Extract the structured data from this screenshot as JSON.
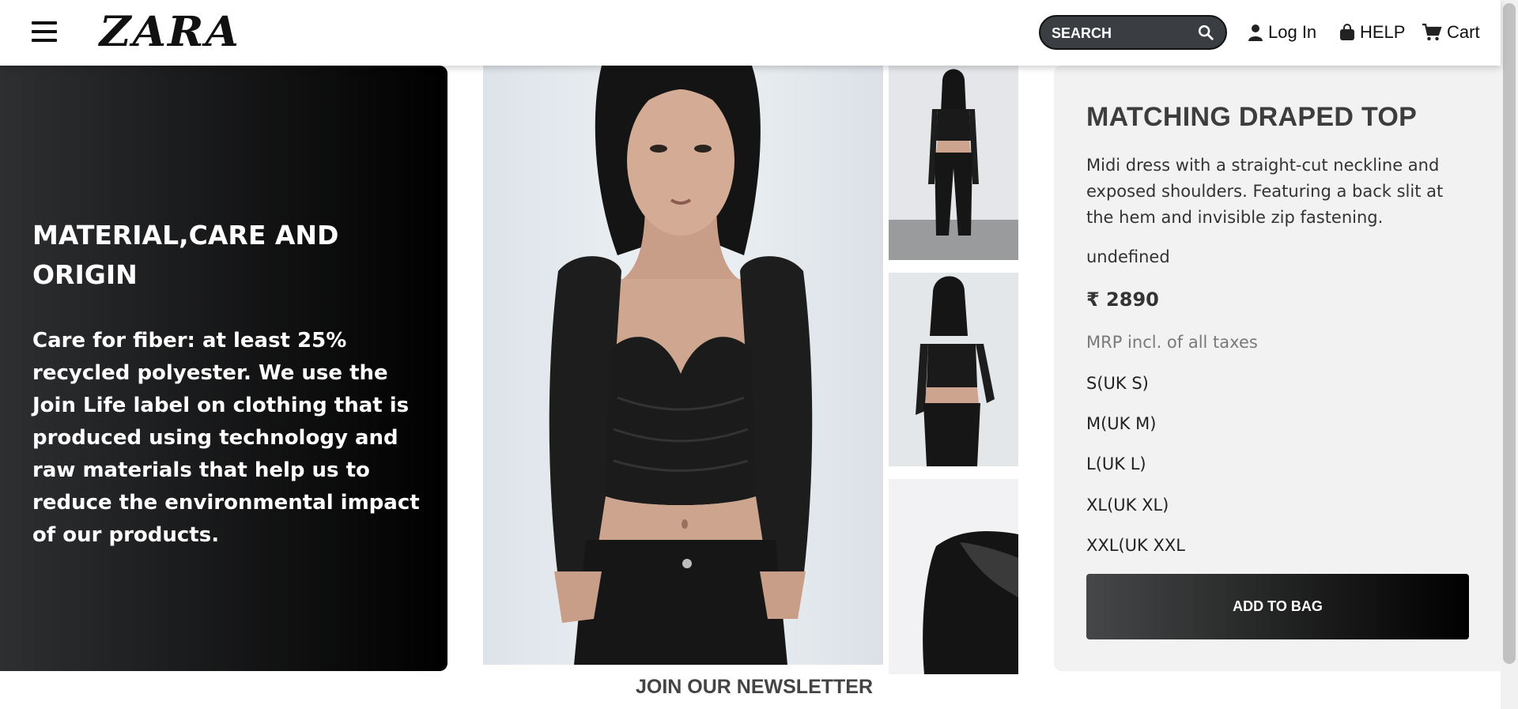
{
  "header": {
    "logo": "ZARA",
    "search_placeholder": "SEARCH",
    "login_label": "Log In",
    "help_label": "HELP",
    "cart_label": "Cart"
  },
  "material": {
    "heading": "MATERIAL,CARE AND ORIGIN",
    "body": "Care for fiber: at least 25% recycled polyester. We use the Join Life label on clothing that is produced using technology and raw materials that help us to reduce the environmental impact of our products."
  },
  "product": {
    "title": "MATCHING DRAPED TOP",
    "description": "Midi dress with a straight-cut neckline and exposed shoulders. Featuring a back slit at the hem and invisible zip fastening.",
    "note": "undefined",
    "price": "₹ 2890",
    "mrp": "MRP incl. of all taxes",
    "sizes": [
      "S(UK S)",
      "M(UK M)",
      "L(UK L)",
      "XL(UK XL)",
      "XXL(UK XXL"
    ],
    "add_to_bag": "ADD TO BAG"
  },
  "footer": {
    "newsletter": "JOIN OUR NEWSLETTER"
  },
  "colors": {
    "panel_dark": "#000000",
    "panel_light": "#f2f2f2",
    "search_bg": "#3a3d41"
  }
}
